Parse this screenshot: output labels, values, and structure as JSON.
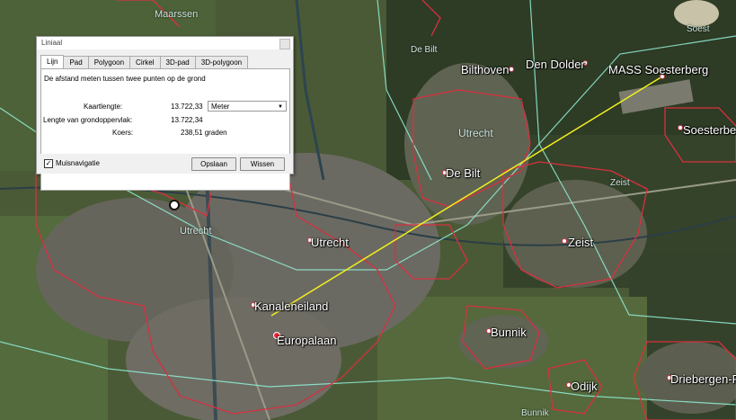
{
  "dialog": {
    "title": "Liniaal",
    "tabs": [
      "Lijn",
      "Pad",
      "Polygoon",
      "Cirkel",
      "3D-pad",
      "3D-polygoon"
    ],
    "description": "De afstand meten tussen twee punten op de grond",
    "map_length_label": "Kaartlengte:",
    "map_length_value": "13.722,33",
    "unit_selected": "Meter",
    "ground_length_label": "Lengte van grondoppervlak:",
    "ground_length_value": "13.722,34",
    "heading_label": "Koers:",
    "heading_value": "238,51 graden",
    "mouse_nav_label": "Muisnavigatie",
    "mouse_nav_checked": "✓",
    "save_button": "Opslaan",
    "clear_button": "Wissen"
  },
  "map": {
    "places": {
      "maarssen": "Maarssen",
      "debilt_small": "De Bilt",
      "bilthoven": "Bilthoven",
      "dendolder": "Den Dolder",
      "soest": "Soest",
      "mass": "MASS Soesterberg",
      "soesterberg": "Soesterberg",
      "utrecht_small_ne": "Utrecht",
      "debilt": "De Bilt",
      "zeist_small": "Zeist",
      "zeist": "Zeist",
      "utrecht_small_w": "Utrecht",
      "utrecht": "Utrecht",
      "kanaleneiland": "Kanaleneiland",
      "europalaan": "Europalaan",
      "bunnik": "Bunnik",
      "bunnik_small": "Bunnik",
      "odijk": "Odijk",
      "driebergen": "Driebergen-Ri"
    },
    "colors": {
      "measure_line": "#f2f01e",
      "municipal_border": "#d8303f",
      "province_border": "#8ee8d0"
    }
  }
}
